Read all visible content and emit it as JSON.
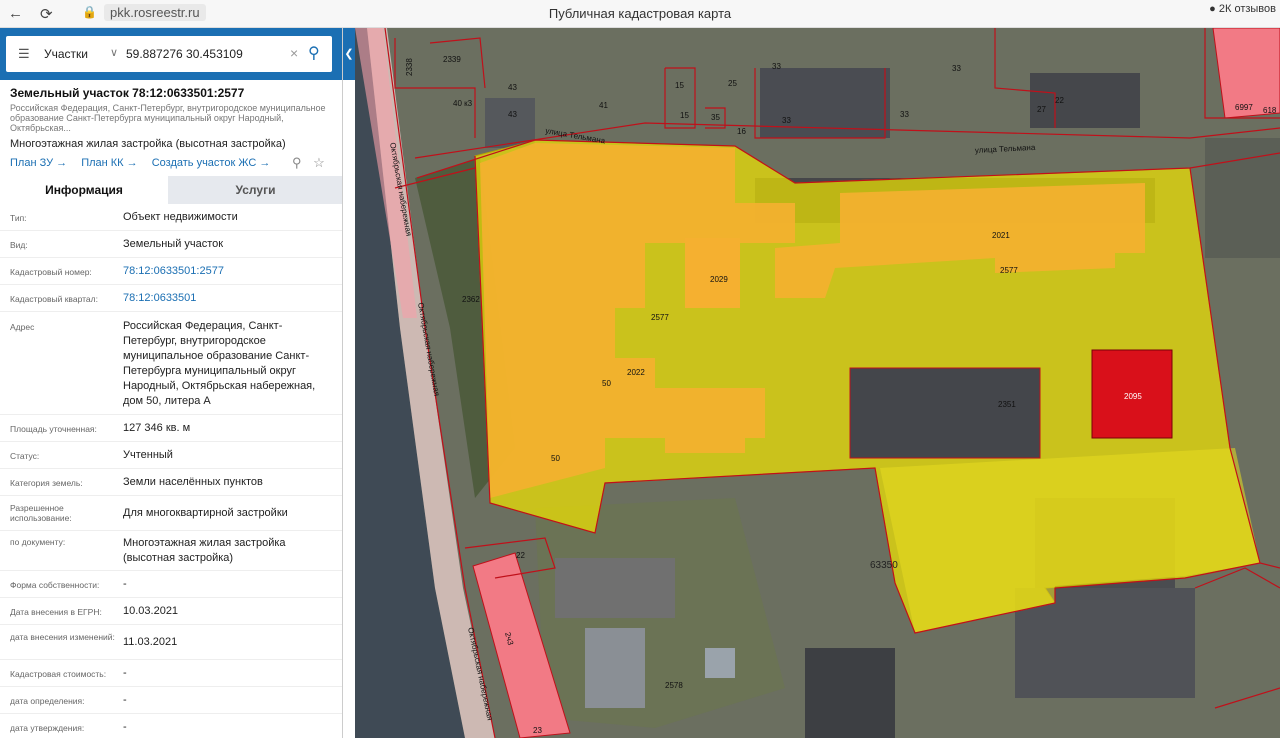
{
  "browser": {
    "back": "←",
    "reload": "⟳",
    "url": "pkk.rosreestr.ru",
    "title": "Публичная кадастровая карта",
    "reviews": "2К отзывов"
  },
  "search": {
    "kind": "Участки",
    "query": "59.887276 30.453109"
  },
  "parcel": {
    "title": "Земельный участок 78:12:0633501:2577",
    "address": "Российская Федерация, Санкт-Петербург, внутригородское муниципальное образование Санкт-Петербурга муниципальный округ Народный, Октябрьская...",
    "use": "Многоэтажная жилая застройка (высотная застройка)",
    "links": [
      "План ЗУ →",
      "План КК →",
      "Создать участок ЖС →"
    ]
  },
  "tabs": {
    "info": "Информация",
    "services": "Услуги"
  },
  "rows": [
    {
      "label": "Тип:",
      "value": "Объект недвижимости"
    },
    {
      "label": "Вид:",
      "value": "Земельный участок"
    },
    {
      "label": "Кадастровый номер:",
      "value": "78:12:0633501:2577"
    },
    {
      "label": "Кадастровый квартал:",
      "value": "78:12:0633501"
    },
    {
      "label": "Адрес",
      "value": "Российская Федерация, Санкт-Петербург, внутригородское муниципальное образование Санкт-Петербурга муниципальный округ Народный, Октябрьская набережная, дом 50, литера А"
    },
    {
      "label": "Площадь уточненная:",
      "value": "127 346 кв. м"
    },
    {
      "label": "Статус:",
      "value": "Учтенный"
    },
    {
      "label": "Категория земель:",
      "value": "Земли населённых пунктов"
    },
    {
      "label": "Разрешенное использование:",
      "value": "Для многоквартирной застройки"
    },
    {
      "label": "по документу:",
      "value": "Многоэтажная жилая застройка (высотная застройка)"
    },
    {
      "label": "Форма собственности:",
      "value": "-"
    },
    {
      "label": "Дата внесения в ЕГРН:",
      "value": "10.03.2021"
    },
    {
      "label": "дата внесения изменений:",
      "value": "11.03.2021"
    },
    {
      "label": "Кадастровая стоимость:",
      "value": "-"
    },
    {
      "label": "дата определения:",
      "value": "-"
    },
    {
      "label": "дата утверждения:",
      "value": "-"
    }
  ],
  "map_labels": {
    "streets": [
      "улица Тельмана",
      "улица Тельмана",
      "Октябрьская набережная",
      "Октябрьская набережная",
      "Октябрьская набережная"
    ],
    "parcels": [
      "2338",
      "2339",
      "40 к3",
      "43",
      "43",
      "41",
      "15",
      "15",
      "25",
      "35",
      "16",
      "33",
      "33",
      "33",
      "33",
      "27",
      "22",
      "6997",
      "618",
      "2362",
      "2022",
      "2021",
      "2029",
      "2577",
      "2577",
      "2351",
      "2095",
      "50",
      "50",
      "22",
      "2578",
      "63350",
      "2ч3",
      "23"
    ]
  },
  "colors": {
    "accent": "#1b6fb3",
    "parcel_yellow": "#f2e600",
    "building_orange": "#f5b030",
    "parcel_red": "#d9101a",
    "pink_lot": "#f27a85",
    "boundary": "#c0101a"
  }
}
